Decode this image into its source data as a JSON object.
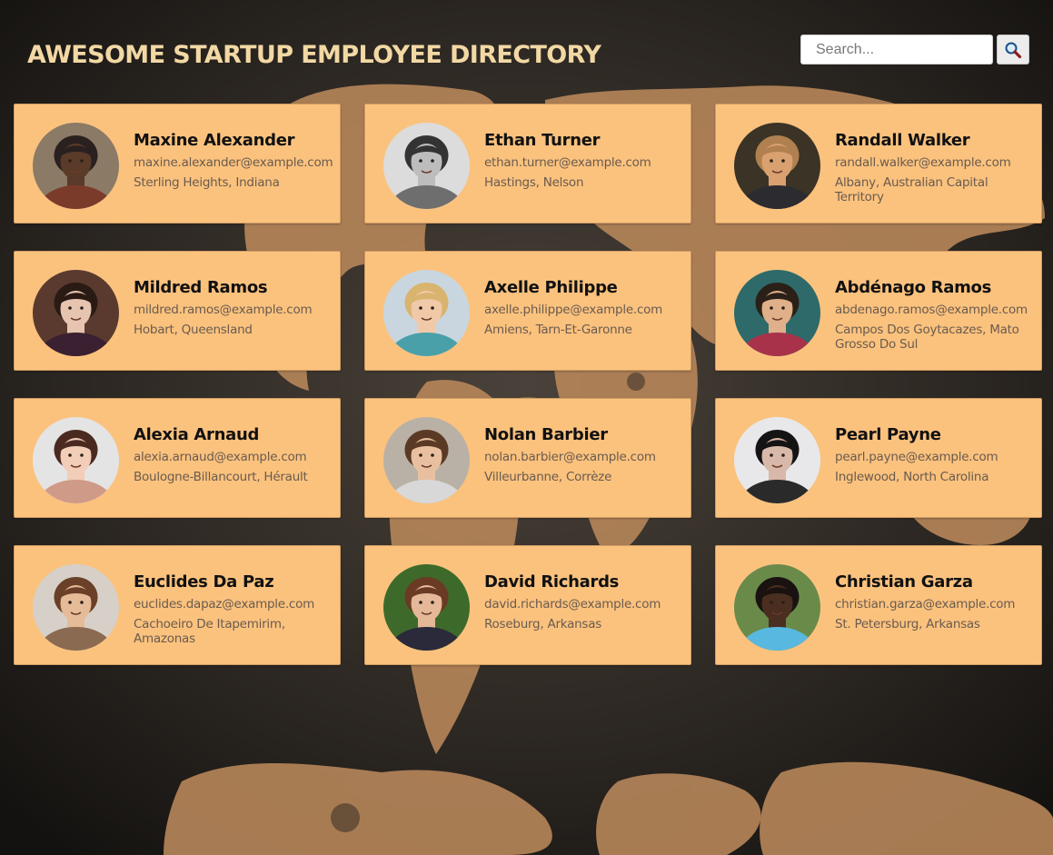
{
  "header": {
    "title": "AWESOME STARTUP EMPLOYEE DIRECTORY",
    "search_placeholder": "Search...",
    "search_icon": "magnifying-glass-icon"
  },
  "colors": {
    "title": "#f2d8a4",
    "card_background": "#fbc27e",
    "page_background": "#24201c",
    "map_land": "#b7865a"
  },
  "employees": [
    {
      "name": "Maxine Alexander",
      "email": "maxine.alexander@example.com",
      "location": "Sterling Heights, Indiana",
      "avatar": {
        "bg": "#8a7a66",
        "skin": "#5a3a28",
        "hair": "#2a2020",
        "shirt": "#7b3b2a"
      }
    },
    {
      "name": "Ethan Turner",
      "email": "ethan.turner@example.com",
      "location": "Hastings, Nelson",
      "avatar": {
        "bg": "#dcdcdc",
        "skin": "#bdbdbd",
        "hair": "#333333",
        "shirt": "#6e6e6e"
      }
    },
    {
      "name": "Randall Walker",
      "email": "randall.walker@example.com",
      "location": "Albany, Australian Capital Territory",
      "avatar": {
        "bg": "#3a3326",
        "skin": "#d9a070",
        "hair": "#b08050",
        "shirt": "#2c2c30"
      }
    },
    {
      "name": "Mildred Ramos",
      "email": "mildred.ramos@example.com",
      "location": "Hobart, Queensland",
      "avatar": {
        "bg": "#5a3a2e",
        "skin": "#e6c4b0",
        "hair": "#2a1a14",
        "shirt": "#3a2030"
      }
    },
    {
      "name": "Axelle Philippe",
      "email": "axelle.philippe@example.com",
      "location": "Amiens, Tarn-Et-Garonne",
      "avatar": {
        "bg": "#c9d6df",
        "skin": "#f0c9a8",
        "hair": "#d8b46e",
        "shirt": "#4aa0a8"
      }
    },
    {
      "name": "Abdénago Ramos",
      "email": "abdenago.ramos@example.com",
      "location": "Campos Dos Goytacazes, Mato Grosso Do Sul",
      "avatar": {
        "bg": "#2e6a6a",
        "skin": "#e0b08a",
        "hair": "#2b2018",
        "shirt": "#a8324a"
      }
    },
    {
      "name": "Alexia Arnaud",
      "email": "alexia.arnaud@example.com",
      "location": "Boulogne-Billancourt, Hérault",
      "avatar": {
        "bg": "#e4e4e4",
        "skin": "#f2cdb8",
        "hair": "#4a2a20",
        "shirt": "#d09a88"
      }
    },
    {
      "name": "Nolan Barbier",
      "email": "nolan.barbier@example.com",
      "location": "Villeurbanne, Corrèze",
      "avatar": {
        "bg": "#b9b1a6",
        "skin": "#e8c0a0",
        "hair": "#5a3a24",
        "shirt": "#d8d8d8"
      }
    },
    {
      "name": "Pearl Payne",
      "email": "pearl.payne@example.com",
      "location": "Inglewood, North Carolina",
      "avatar": {
        "bg": "#e8e8ea",
        "skin": "#d8b8a8",
        "hair": "#141414",
        "shirt": "#2a2a2a"
      }
    },
    {
      "name": "Euclides Da Paz",
      "email": "euclides.dapaz@example.com",
      "location": "Cachoeiro De Itapemirim, Amazonas",
      "avatar": {
        "bg": "#d6d0c8",
        "skin": "#e6bb98",
        "hair": "#6a4028",
        "shirt": "#8a6a50"
      }
    },
    {
      "name": "David Richards",
      "email": "david.richards@example.com",
      "location": "Roseburg, Arkansas",
      "avatar": {
        "bg": "#3d6a2a",
        "skin": "#e4b898",
        "hair": "#6a3a24",
        "shirt": "#2a2a3a"
      }
    },
    {
      "name": "Christian Garza",
      "email": "christian.garza@example.com",
      "location": "St. Petersburg, Arkansas",
      "avatar": {
        "bg": "#6a8a4a",
        "skin": "#4a2e20",
        "hair": "#1a1210",
        "shirt": "#58b8e0"
      }
    }
  ]
}
